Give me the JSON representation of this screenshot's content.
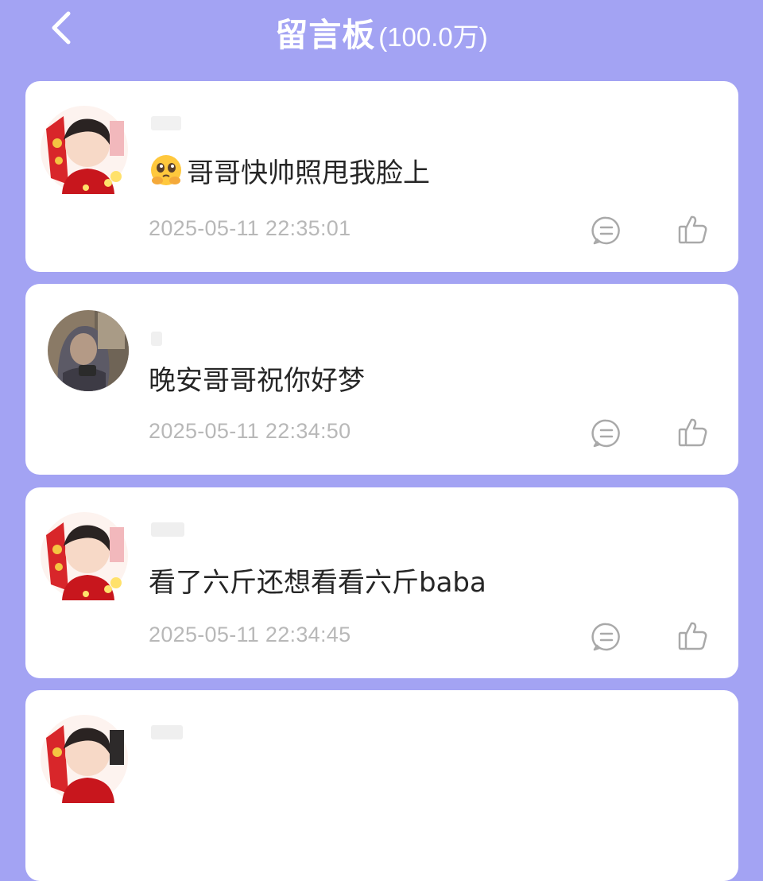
{
  "header": {
    "title": "留言板",
    "count": "(100.0万)",
    "back_icon": "chevron-left-icon"
  },
  "colors": {
    "background": "#a3a3f3",
    "card": "#ffffff",
    "text": "#262626",
    "timestamp": "#b8b8b8",
    "icon": "#a9a9a9"
  },
  "messages": [
    {
      "avatar": "idol-portrait-red-frame",
      "emoji": "pleading-hug-emoji",
      "text": "哥哥快帅照甩我脸上",
      "timestamp": "2025-05-11 22:35:01"
    },
    {
      "avatar": "hooded-person-photo",
      "text": "晚安哥哥祝你好梦",
      "timestamp": "2025-05-11 22:34:50"
    },
    {
      "avatar": "idol-portrait-red-frame",
      "text": "看了六斤还想看看六斤baba",
      "timestamp": "2025-05-11 22:34:45"
    },
    {
      "avatar": "idol-portrait-red-frame"
    }
  ]
}
